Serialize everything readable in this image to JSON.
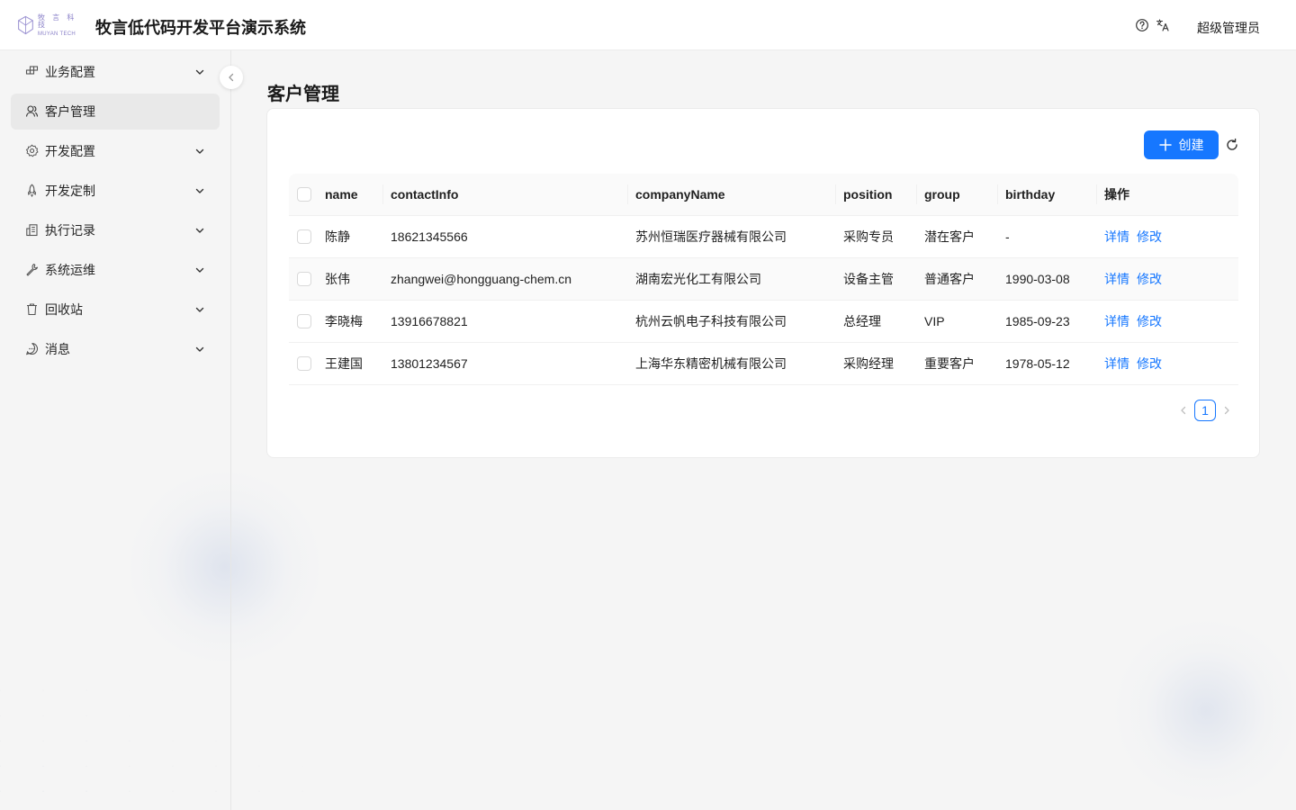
{
  "header": {
    "logo_cn": "牧 言 科 技",
    "logo_en": "MUYAN TECH",
    "title": "牧言低代码开发平台演示系统",
    "icons": [
      "help-circle-icon",
      "translate-icon"
    ],
    "user": "超级管理员"
  },
  "sidebar": {
    "items": [
      {
        "label": "业务配置",
        "icon": "blocks-icon",
        "has_submenu": true,
        "active": false
      },
      {
        "label": "客户管理",
        "icon": "users-icon",
        "has_submenu": false,
        "active": true
      },
      {
        "label": "开发配置",
        "icon": "gear-icon",
        "has_submenu": true,
        "active": false
      },
      {
        "label": "开发定制",
        "icon": "rocket-icon",
        "has_submenu": true,
        "active": false
      },
      {
        "label": "执行记录",
        "icon": "building-icon",
        "has_submenu": true,
        "active": false
      },
      {
        "label": "系统运维",
        "icon": "wrench-icon",
        "has_submenu": true,
        "active": false
      },
      {
        "label": "回收站",
        "icon": "trash-icon",
        "has_submenu": true,
        "active": false
      },
      {
        "label": "消息",
        "icon": "message-icon",
        "has_submenu": true,
        "active": false
      }
    ]
  },
  "page": {
    "title": "客户管理",
    "create_label": "创建"
  },
  "table": {
    "columns": [
      "name",
      "contactInfo",
      "companyName",
      "position",
      "group",
      "birthday",
      "操作"
    ],
    "rows": [
      {
        "name": "陈静",
        "contactInfo": "18621345566",
        "companyName": "苏州恒瑞医疗器械有限公司",
        "position": "采购专员",
        "group": "潜在客户",
        "birthday": "-",
        "action_detail": "详情",
        "action_edit": "修改"
      },
      {
        "name": "张伟",
        "contactInfo": "zhangwei@hongguang-chem.cn",
        "companyName": "湖南宏光化工有限公司",
        "position": "设备主管",
        "group": "普通客户",
        "birthday": "1990-03-08",
        "action_detail": "详情",
        "action_edit": "修改"
      },
      {
        "name": "李晓梅",
        "contactInfo": "13916678821",
        "companyName": "杭州云帆电子科技有限公司",
        "position": "总经理",
        "group": "VIP",
        "birthday": "1985-09-23",
        "action_detail": "详情",
        "action_edit": "修改"
      },
      {
        "name": "王建国",
        "contactInfo": "13801234567",
        "companyName": "上海华东精密机械有限公司",
        "position": "采购经理",
        "group": "重要客户",
        "birthday": "1978-05-12",
        "action_detail": "详情",
        "action_edit": "修改"
      }
    ]
  },
  "pagination": {
    "current_page": "1"
  },
  "colors": {
    "primary": "#1677ff",
    "active_menu_bg": "#e9e9e9",
    "logo": "#8a80c8"
  }
}
